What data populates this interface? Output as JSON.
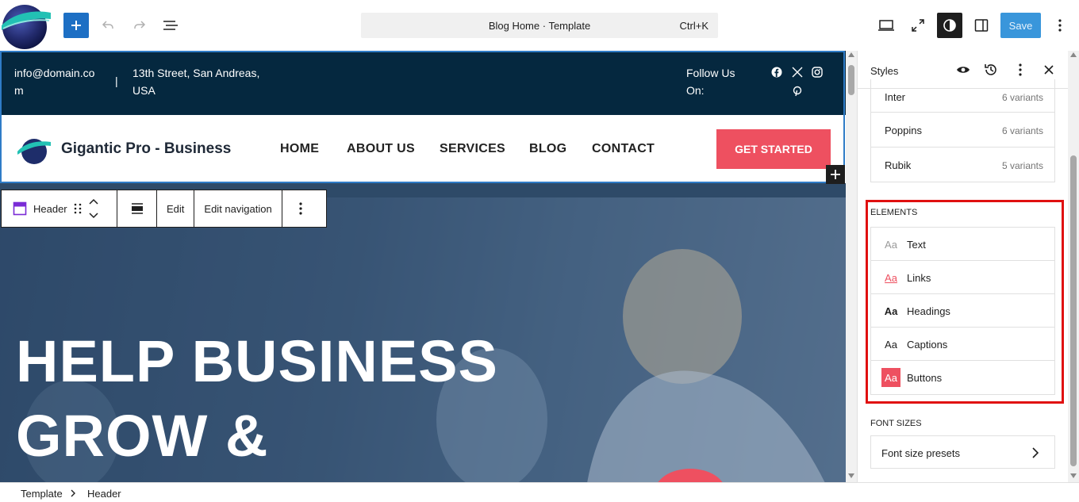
{
  "topbar": {
    "command_title": "Blog Home · Template",
    "command_shortcut": "Ctrl+K",
    "save_label": "Save",
    "icons": [
      "site-logo",
      "add-block-icon",
      "undo-icon",
      "redo-icon",
      "document-overview-icon",
      "desktop-preview-icon",
      "fullscreen-icon",
      "contrast-icon",
      "sidebar-toggle-icon",
      "more-options-icon"
    ]
  },
  "canvas": {
    "top_bar": {
      "email": "info@domain.co",
      "email_wrap": "m",
      "divider": "|",
      "address_line1": "13th Street, San Andreas,",
      "address_line2": "USA",
      "follow_line1": "Follow Us",
      "follow_line2": "On:",
      "social_icons": [
        "facebook-icon",
        "x-icon",
        "instagram-icon",
        "pinterest-icon"
      ]
    },
    "nav": {
      "brand": "Gigantic Pro - Business",
      "items": [
        "HOME",
        "ABOUT US",
        "SERVICES",
        "BLOG",
        "CONTACT"
      ],
      "cta": "GET STARTED"
    },
    "hero": {
      "line1": "HELP BUSINESS",
      "line2": "GROW &"
    },
    "block_toolbar": {
      "block_name": "Header",
      "edit": "Edit",
      "edit_navigation": "Edit navigation"
    }
  },
  "panel": {
    "title": "Styles",
    "fonts": [
      {
        "name": "Inter",
        "variants": "6 variants"
      },
      {
        "name": "Poppins",
        "variants": "6 variants"
      },
      {
        "name": "Rubik",
        "variants": "5 variants"
      }
    ],
    "elements_label": "ELEMENTS",
    "elements": [
      {
        "icon": "Aa",
        "label": "Text"
      },
      {
        "icon": "Aa",
        "label": "Links"
      },
      {
        "icon": "Aa",
        "label": "Headings"
      },
      {
        "icon": "Aa",
        "label": "Captions"
      },
      {
        "icon": "Aa",
        "label": "Buttons"
      }
    ],
    "font_sizes_label": "FONT SIZES",
    "font_size_presets": "Font size presets"
  },
  "breadcrumb": {
    "items": [
      "Template",
      "Header"
    ]
  },
  "colors": {
    "accent": "#1d6fc4",
    "header_dark": "#05283f",
    "cta": "#ee5060",
    "highlight": "#e01010"
  }
}
